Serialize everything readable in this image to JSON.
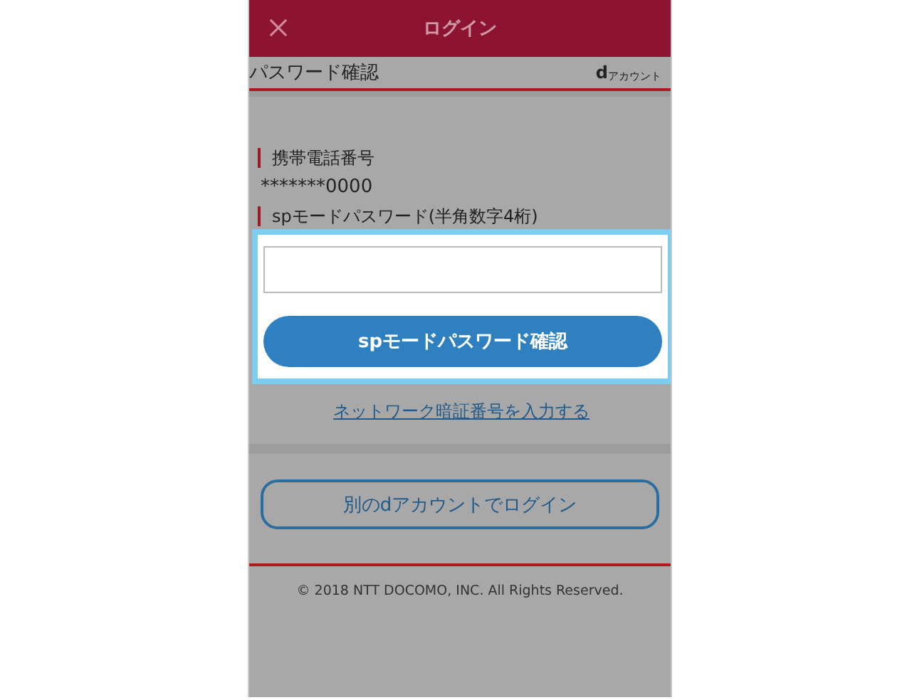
{
  "header": {
    "title": "ログイン"
  },
  "page_title": {
    "text": "パスワード確認",
    "brand_mark": "d",
    "brand_text": "アカウント"
  },
  "fields": [
    {
      "kind": "display",
      "label": "携帯電話番号",
      "value": "*******0000"
    },
    {
      "kind": "input",
      "label": "spモードパスワード(半角数字4桁)"
    }
  ],
  "highlight": {
    "on": true
  },
  "confirm_button": "spモードパスワード確認",
  "network_link": "ネットワーク暗証番号を入力する",
  "other_account_button": "別のdアカウントでログイン",
  "footer": "© 2018 NTT DOCOMO, INC. All Rights Reserved."
}
